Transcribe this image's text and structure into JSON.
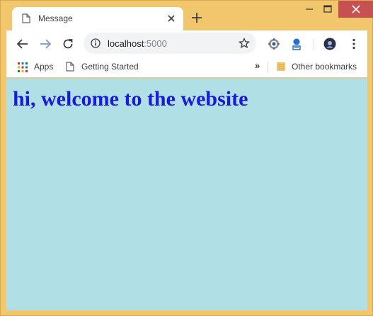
{
  "tab": {
    "title": "Message"
  },
  "address_bar": {
    "host": "localhost",
    "port": ":5000"
  },
  "bookmarks": {
    "apps_label": "Apps",
    "getting_started_label": "Getting Started",
    "overflow_label": "»",
    "other_label": "Other bookmarks"
  },
  "page": {
    "heading": "hi, welcome to the website"
  },
  "colors": {
    "frame": "#f2c66d",
    "content_bg": "#b0dfe6",
    "heading": "#1a1adc",
    "close_button": "#c75050"
  }
}
